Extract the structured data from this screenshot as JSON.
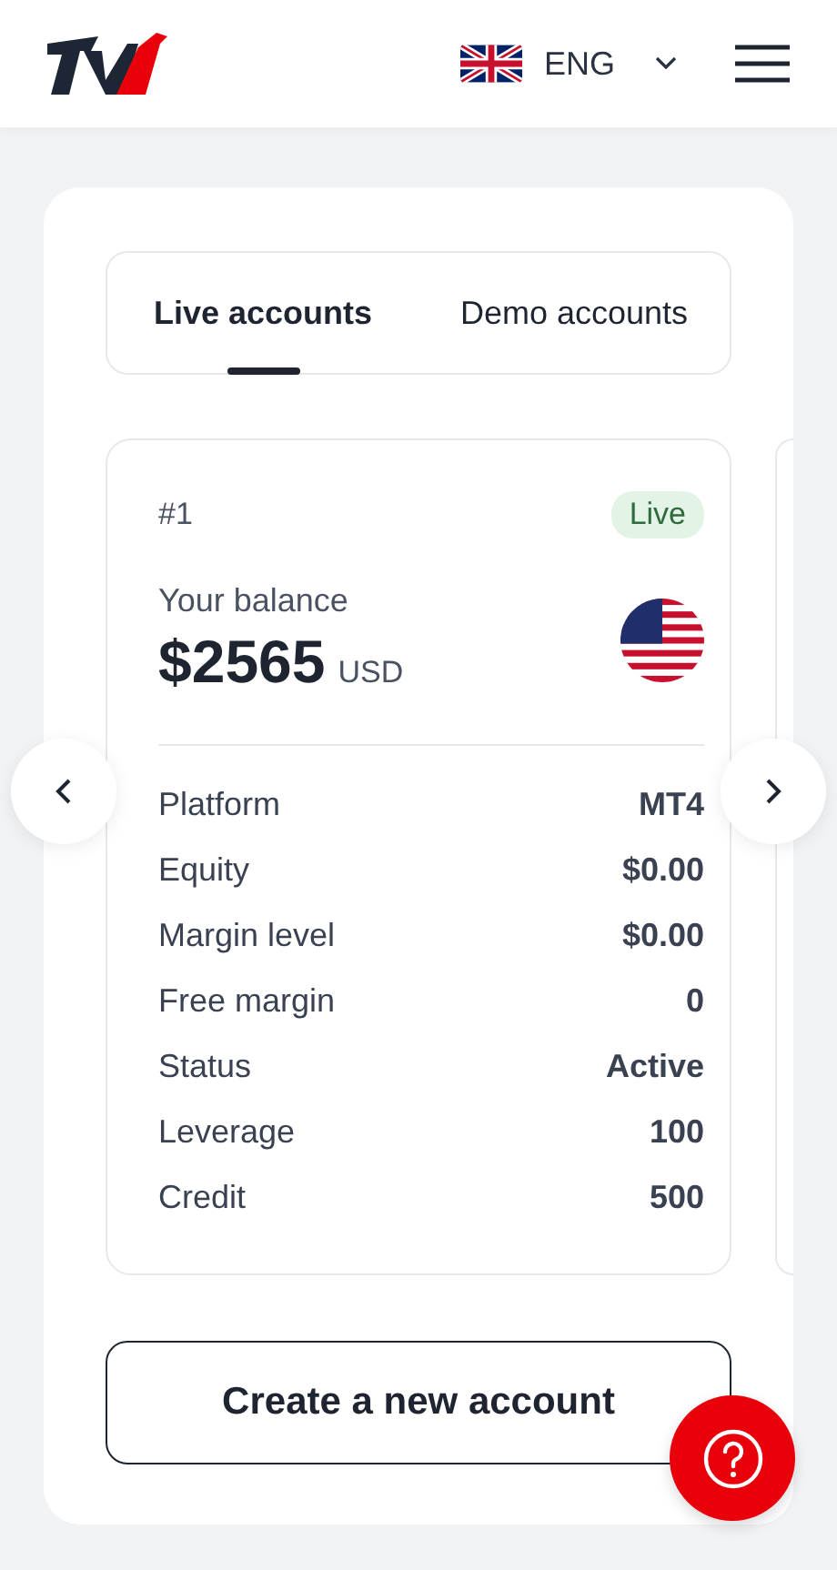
{
  "header": {
    "language": "ENG"
  },
  "tabs": [
    {
      "label": "Live accounts",
      "selected": true
    },
    {
      "label": "Demo accounts",
      "selected": false
    }
  ],
  "account": {
    "number": "#1",
    "badge": "Live",
    "balance_label": "Your balance",
    "balance": "$2565",
    "currency": "USD",
    "details": [
      {
        "label": "Platform",
        "value": "MT4"
      },
      {
        "label": "Equity",
        "value": "$0.00"
      },
      {
        "label": "Margin level",
        "value": "$0.00"
      },
      {
        "label": "Free margin",
        "value": "0"
      },
      {
        "label": "Status",
        "value": "Active"
      },
      {
        "label": "Leverage",
        "value": "100"
      },
      {
        "label": "Credit",
        "value": "500"
      }
    ]
  },
  "create_button": "Create a new account"
}
